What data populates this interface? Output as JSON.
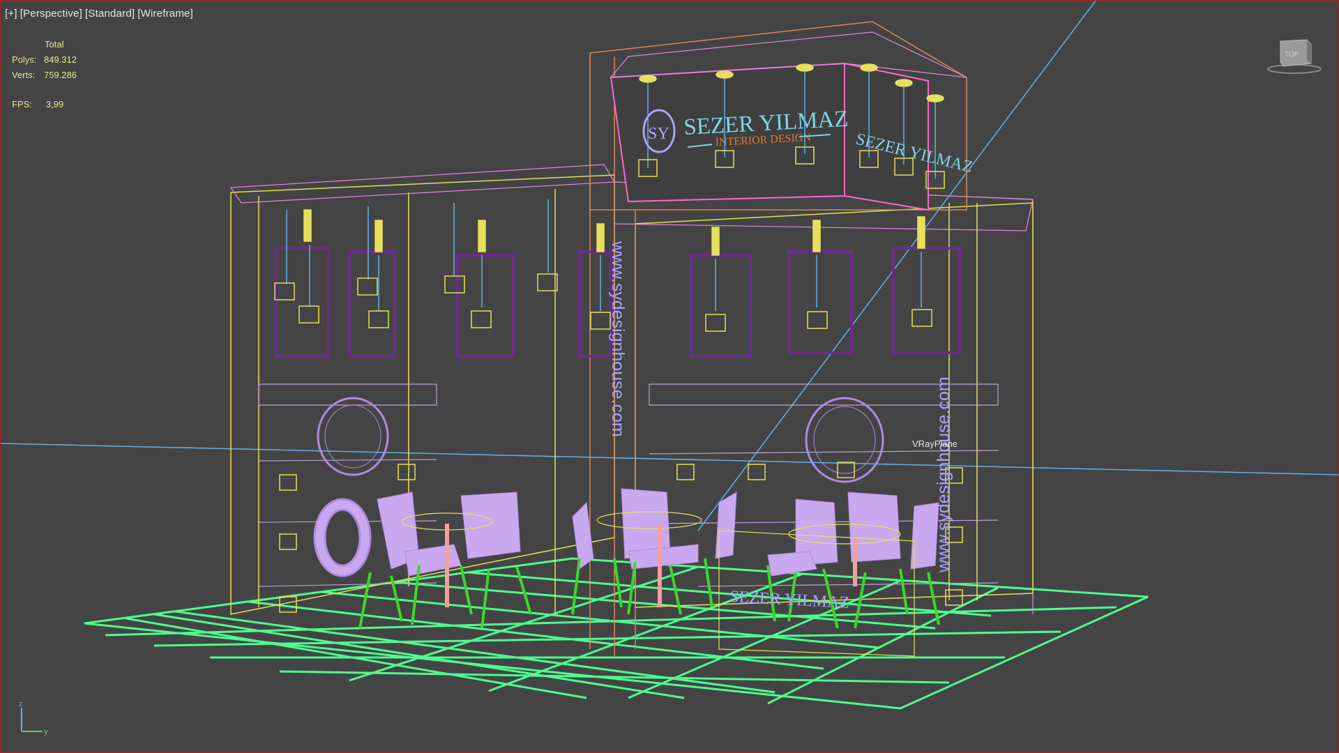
{
  "viewport": {
    "labels": [
      "[+]",
      "[Perspective]",
      "[Standard]",
      "[Wireframe]"
    ]
  },
  "stats": {
    "header": "Total",
    "polys_label": "Polys:",
    "polys_value": "849.312",
    "verts_label": "Verts:",
    "verts_value": "759.286",
    "fps_label": "FPS:",
    "fps_value": "3,99"
  },
  "scene": {
    "brand_name": "SEZER YILMAZ",
    "brand_sub": "INTERIOR DESIGN",
    "brand_monogram": "SY",
    "website": "www.sydesignhouse.com",
    "object_label": "VRayPlane"
  },
  "viewcube": {
    "label": "TOP"
  },
  "axis": {
    "z": "z",
    "y": "y"
  },
  "colors": {
    "background": "#444444",
    "floor_grid": "#4dff8f",
    "wire_pink": "#e08adf",
    "wire_yellow": "#e7e05c",
    "wire_purple": "#6b2a8c",
    "furniture": "#c9a8f0",
    "plant": "#3dd62e",
    "horizon": "#5fb3e8",
    "brand_teal": "#7ed6e0",
    "brand_orange": "#e07a2a"
  },
  "icons": [
    "viewcube-icon",
    "axis-tripod-icon"
  ]
}
